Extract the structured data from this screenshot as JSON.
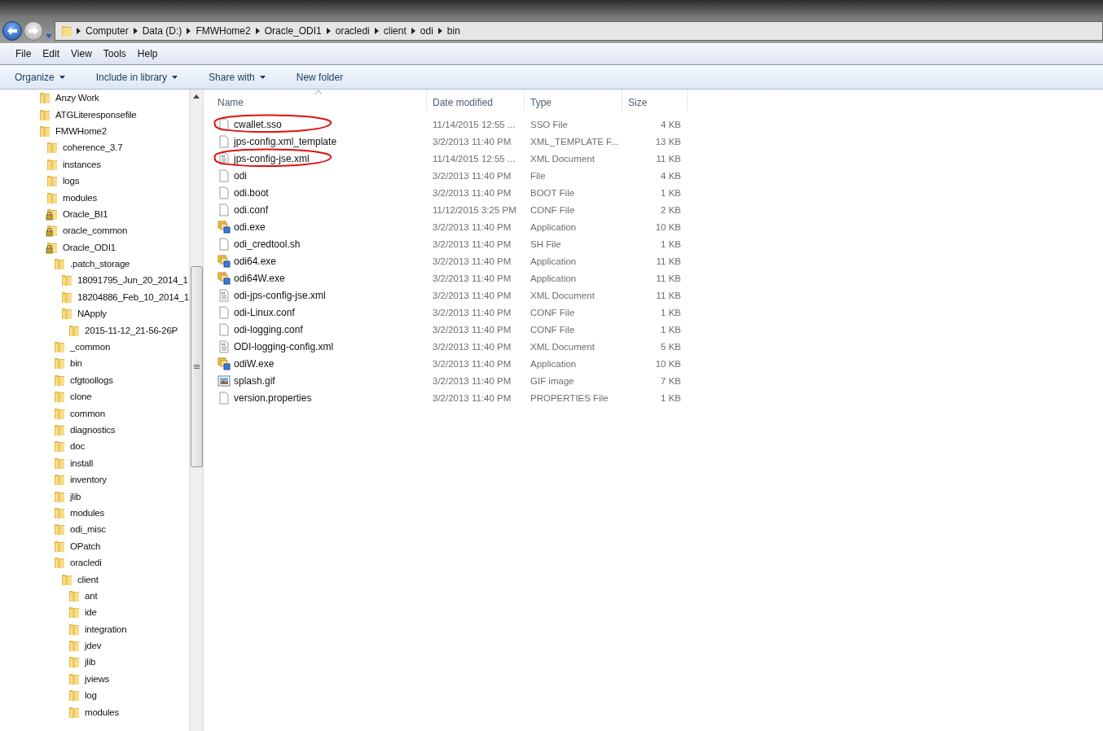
{
  "address_bar": {
    "segments": [
      "Computer",
      "Data (D:)",
      "FMWHome2",
      "Oracle_ODI1",
      "oracledi",
      "client",
      "odi",
      "bin"
    ]
  },
  "menu_bar": [
    "File",
    "Edit",
    "View",
    "Tools",
    "Help"
  ],
  "toolbar": [
    {
      "label": "Organize",
      "dropdown": true
    },
    {
      "label": "Include in library",
      "dropdown": true
    },
    {
      "label": "Share with",
      "dropdown": true
    },
    {
      "label": "New folder",
      "dropdown": false
    }
  ],
  "sidebar": {
    "items": [
      {
        "label": "Anzy Work",
        "locked": false
      },
      {
        "label": "ATGLiteresponsefile",
        "locked": false
      },
      {
        "label": "FMWHome2",
        "locked": false,
        "children": [
          {
            "label": "coherence_3.7",
            "locked": false
          },
          {
            "label": "instances",
            "locked": false
          },
          {
            "label": "logs",
            "locked": false
          },
          {
            "label": "modules",
            "locked": false
          },
          {
            "label": "Oracle_BI1",
            "locked": true
          },
          {
            "label": "oracle_common",
            "locked": true
          },
          {
            "label": "Oracle_ODI1",
            "locked": true,
            "children": [
              {
                "label": ".patch_storage",
                "locked": false,
                "children": [
                  {
                    "label": "18091795_Jun_20_2014_1",
                    "locked": false
                  },
                  {
                    "label": "18204886_Feb_10_2014_1",
                    "locked": false
                  },
                  {
                    "label": "NApply",
                    "locked": false,
                    "children": [
                      {
                        "label": "2015-11-12_21-56-26P",
                        "locked": false
                      }
                    ]
                  }
                ]
              },
              {
                "label": "_common",
                "locked": false
              },
              {
                "label": "bin",
                "locked": false
              },
              {
                "label": "cfgtoollogs",
                "locked": false
              },
              {
                "label": "clone",
                "locked": false
              },
              {
                "label": "common",
                "locked": false
              },
              {
                "label": "diagnostics",
                "locked": false
              },
              {
                "label": "doc",
                "locked": false
              },
              {
                "label": "install",
                "locked": false
              },
              {
                "label": "inventory",
                "locked": false
              },
              {
                "label": "jlib",
                "locked": false
              },
              {
                "label": "modules",
                "locked": false
              },
              {
                "label": "odi_misc",
                "locked": false
              },
              {
                "label": "OPatch",
                "locked": false
              },
              {
                "label": "oracledi",
                "locked": false,
                "children": [
                  {
                    "label": "client",
                    "locked": false,
                    "children": [
                      {
                        "label": "ant",
                        "locked": false
                      },
                      {
                        "label": "ide",
                        "locked": false
                      },
                      {
                        "label": "integration",
                        "locked": false
                      },
                      {
                        "label": "jdev",
                        "locked": false
                      },
                      {
                        "label": "jlib",
                        "locked": false
                      },
                      {
                        "label": "jviews",
                        "locked": false
                      },
                      {
                        "label": "log",
                        "locked": false
                      },
                      {
                        "label": "modules",
                        "locked": false
                      }
                    ]
                  }
                ]
              }
            ]
          }
        ]
      }
    ]
  },
  "table": {
    "columns": [
      "Name",
      "Date modified",
      "Type",
      "Size"
    ],
    "rows": [
      {
        "kind": "blank",
        "name": "cwallet.sso",
        "date": "11/14/2015 12:55 ...",
        "type": "SSO File",
        "size": "4 KB",
        "circled": true
      },
      {
        "kind": "blank",
        "name": "jps-config.xml_template",
        "date": "3/2/2013 11:40 PM",
        "type": "XML_TEMPLATE F...",
        "size": "13 KB",
        "circled": false
      },
      {
        "kind": "xml",
        "name": "jps-config-jse.xml",
        "date": "11/14/2015 12:55 ...",
        "type": "XML Document",
        "size": "11 KB",
        "circled": true
      },
      {
        "kind": "blank",
        "name": "odi",
        "date": "3/2/2013 11:40 PM",
        "type": "File",
        "size": "4 KB",
        "circled": false
      },
      {
        "kind": "blank",
        "name": "odi.boot",
        "date": "3/2/2013 11:40 PM",
        "type": "BOOT File",
        "size": "1 KB",
        "circled": false
      },
      {
        "kind": "blank",
        "name": "odi.conf",
        "date": "11/12/2015 3:25 PM",
        "type": "CONF File",
        "size": "2 KB",
        "circled": false
      },
      {
        "kind": "exe",
        "name": "odi.exe",
        "date": "3/2/2013 11:40 PM",
        "type": "Application",
        "size": "10 KB",
        "circled": false
      },
      {
        "kind": "blank",
        "name": "odi_credtool.sh",
        "date": "3/2/2013 11:40 PM",
        "type": "SH File",
        "size": "1 KB",
        "circled": false
      },
      {
        "kind": "exe",
        "name": "odi64.exe",
        "date": "3/2/2013 11:40 PM",
        "type": "Application",
        "size": "11 KB",
        "circled": false
      },
      {
        "kind": "exe",
        "name": "odi64W.exe",
        "date": "3/2/2013 11:40 PM",
        "type": "Application",
        "size": "11 KB",
        "circled": false
      },
      {
        "kind": "xml",
        "name": "odi-jps-config-jse.xml",
        "date": "3/2/2013 11:40 PM",
        "type": "XML Document",
        "size": "11 KB",
        "circled": false
      },
      {
        "kind": "blank",
        "name": "odi-Linux.conf",
        "date": "3/2/2013 11:40 PM",
        "type": "CONF File",
        "size": "1 KB",
        "circled": false
      },
      {
        "kind": "blank",
        "name": "odi-logging.conf",
        "date": "3/2/2013 11:40 PM",
        "type": "CONF File",
        "size": "1 KB",
        "circled": false
      },
      {
        "kind": "xml",
        "name": "ODI-logging-config.xml",
        "date": "3/2/2013 11:40 PM",
        "type": "XML Document",
        "size": "5 KB",
        "circled": false
      },
      {
        "kind": "exe",
        "name": "odiW.exe",
        "date": "3/2/2013 11:40 PM",
        "type": "Application",
        "size": "10 KB",
        "circled": false
      },
      {
        "kind": "gif",
        "name": "splash.gif",
        "date": "3/2/2013 11:40 PM",
        "type": "GIF image",
        "size": "7 KB",
        "circled": false
      },
      {
        "kind": "blank",
        "name": "version.properties",
        "date": "3/2/2013 11:40 PM",
        "type": "PROPERTIES File",
        "size": "1 KB",
        "circled": false
      }
    ]
  }
}
